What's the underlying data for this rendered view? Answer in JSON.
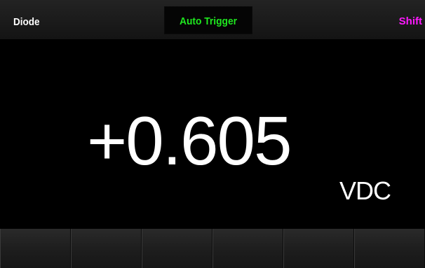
{
  "status_bar": {
    "mode": "Diode",
    "trigger": "Auto Trigger",
    "shift": "Shift"
  },
  "display": {
    "reading": "+0.605",
    "unit": "VDC"
  },
  "softkeys": [
    "",
    "",
    "",
    "",
    "",
    ""
  ],
  "colors": {
    "background": "#000000",
    "trigger_text": "#1fe81f",
    "shift_text": "#ff19ff",
    "mode_text": "#ffffff"
  }
}
